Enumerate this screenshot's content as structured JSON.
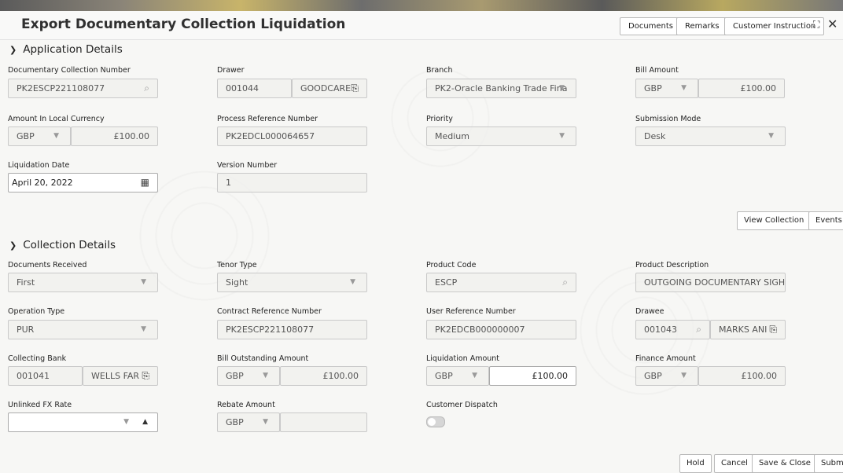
{
  "header": {
    "title": "Export Documentary Collection Liquidation",
    "buttons": {
      "documents": "Documents",
      "remarks": "Remarks",
      "customer_instruction": "Customer Instruction"
    }
  },
  "application": {
    "section_title": "Application Details",
    "doc_collection_number": {
      "label": "Documentary Collection Number",
      "value": "PK2ESCP221108077"
    },
    "drawer": {
      "label": "Drawer",
      "id": "001044",
      "name": "GOODCARE"
    },
    "branch": {
      "label": "Branch",
      "value": "PK2-Oracle Banking Trade Fina"
    },
    "bill_amount": {
      "label": "Bill Amount",
      "currency": "GBP",
      "amount": "£100.00"
    },
    "amount_local": {
      "label": "Amount In Local Currency",
      "currency": "GBP",
      "amount": "£100.00"
    },
    "process_ref": {
      "label": "Process Reference Number",
      "value": "PK2EDCL000064657"
    },
    "priority": {
      "label": "Priority",
      "value": "Medium"
    },
    "submission_mode": {
      "label": "Submission Mode",
      "value": "Desk"
    },
    "liquidation_date": {
      "label": "Liquidation Date",
      "value": "April 20, 2022"
    },
    "version_number": {
      "label": "Version Number",
      "value": "1"
    },
    "buttons": {
      "view_collection": "View Collection",
      "events": "Events"
    }
  },
  "collection": {
    "section_title": "Collection Details",
    "documents_received": {
      "label": "Documents Received",
      "value": "First"
    },
    "tenor_type": {
      "label": "Tenor Type",
      "value": "Sight"
    },
    "product_code": {
      "label": "Product Code",
      "value": "ESCP"
    },
    "product_description": {
      "label": "Product Description",
      "value": "OUTGOING DOCUMENTARY SIGHT"
    },
    "operation_type": {
      "label": "Operation Type",
      "value": "PUR"
    },
    "contract_ref": {
      "label": "Contract Reference Number",
      "value": "PK2ESCP221108077"
    },
    "user_ref": {
      "label": "User Reference Number",
      "value": "PK2EDCB000000007"
    },
    "drawee": {
      "label": "Drawee",
      "id": "001043",
      "name": "MARKS ANI"
    },
    "collecting_bank": {
      "label": "Collecting Bank",
      "id": "001041",
      "name": "WELLS FAR"
    },
    "bill_outstanding": {
      "label": "Bill Outstanding Amount",
      "currency": "GBP",
      "amount": "£100.00"
    },
    "liquidation_amount": {
      "label": "Liquidation Amount",
      "currency": "GBP",
      "amount": "£100.00"
    },
    "finance_amount": {
      "label": "Finance Amount",
      "currency": "GBP",
      "amount": "£100.00"
    },
    "unlinked_fx": {
      "label": "Unlinked FX Rate",
      "value": ""
    },
    "rebate_amount": {
      "label": "Rebate Amount",
      "currency": "GBP",
      "amount": ""
    },
    "customer_dispatch": {
      "label": "Customer Dispatch",
      "on": false
    }
  },
  "footer": {
    "hold": "Hold",
    "cancel": "Cancel",
    "save_close": "Save & Close",
    "submit": "Submit"
  }
}
